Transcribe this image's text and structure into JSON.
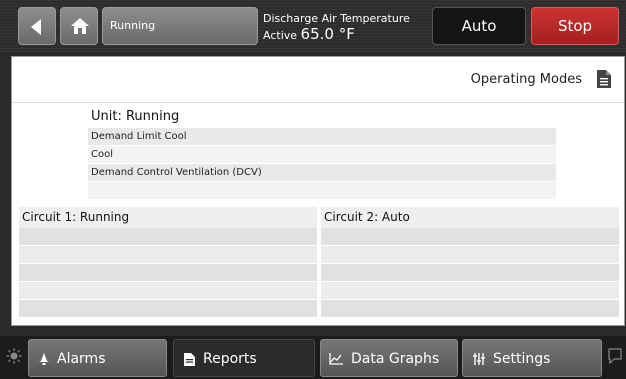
{
  "header": {
    "status_label": "Running",
    "readout": {
      "title": "Discharge Air Temperature",
      "status": "Active",
      "value": "65.0 °F"
    },
    "auto_label": "Auto",
    "stop_label": "Stop",
    "colors": {
      "stop": "#b52626",
      "auto": "#141414"
    }
  },
  "panel": {
    "title": "Operating Modes",
    "unit": {
      "heading": "Unit:  Running",
      "rows": [
        "Demand Limit Cool",
        "Cool",
        "Demand Control Ventilation (DCV)",
        ""
      ]
    },
    "circuits": [
      {
        "heading": "Circuit 1:  Running",
        "rows": [
          "",
          "",
          "",
          "",
          ""
        ]
      },
      {
        "heading": "Circuit 2:  Auto",
        "rows": [
          "",
          "",
          "",
          "",
          ""
        ]
      }
    ]
  },
  "footer": {
    "tabs": [
      {
        "label": "Alarms",
        "icon": "bell-icon"
      },
      {
        "label": "Reports",
        "icon": "report-icon"
      },
      {
        "label": "Data Graphs",
        "icon": "graph-icon"
      },
      {
        "label": "Settings",
        "icon": "sliders-icon"
      }
    ]
  }
}
